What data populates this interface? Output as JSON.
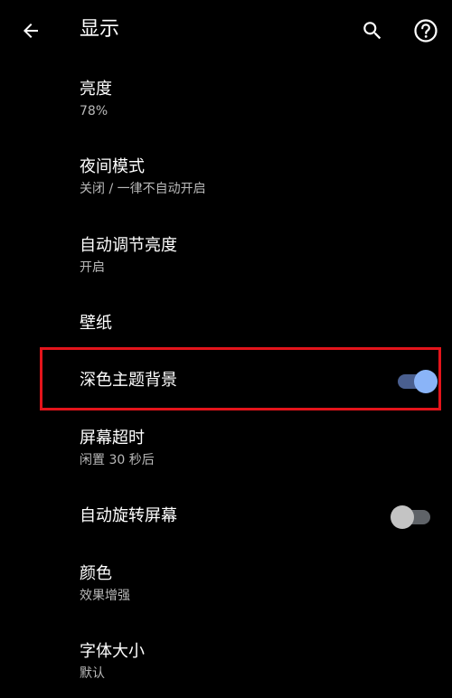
{
  "header": {
    "title": "显示",
    "back_icon": "arrow-back-icon",
    "search_icon": "search-icon",
    "help_icon": "help-icon"
  },
  "settings": {
    "brightness": {
      "title": "亮度",
      "summary": "78%"
    },
    "night_mode": {
      "title": "夜间模式",
      "summary": "关闭 / 一律不自动开启"
    },
    "adaptive_brightness": {
      "title": "自动调节亮度",
      "summary": "开启"
    },
    "wallpaper": {
      "title": "壁纸"
    },
    "dark_theme": {
      "title": "深色主题背景",
      "enabled": true
    },
    "screen_timeout": {
      "title": "屏幕超时",
      "summary": "闲置 30 秒后"
    },
    "auto_rotate": {
      "title": "自动旋转屏幕",
      "enabled": false
    },
    "colors": {
      "title": "颜色",
      "summary": "效果增强"
    },
    "font_size": {
      "title": "字体大小",
      "summary": "默认"
    }
  },
  "colors": {
    "background": "#000000",
    "accent": "#8ab4f8",
    "highlight": "#e3141b",
    "secondary_text": "#b9b9b9"
  }
}
